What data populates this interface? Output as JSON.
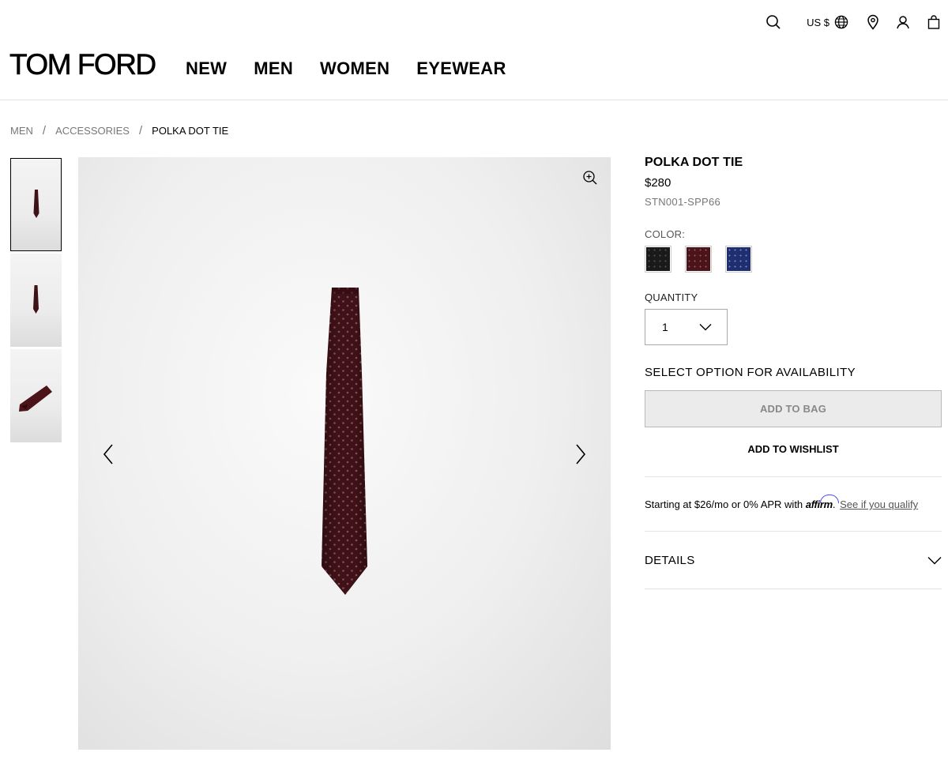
{
  "header": {
    "logo": "TOM FORD",
    "currency": "US $",
    "nav": [
      "NEW",
      "MEN",
      "WOMEN",
      "EYEWEAR"
    ],
    "icons": [
      "search-icon",
      "globe-icon",
      "location-pin-icon",
      "account-icon",
      "shopping-bag-icon"
    ]
  },
  "breadcrumb": [
    "MEN",
    "ACCESSORIES",
    "POLKA DOT TIE"
  ],
  "gallery": {
    "thumbnail_count": 3,
    "active_thumbnail": 0
  },
  "product": {
    "title": "POLKA DOT TIE",
    "price": "$280",
    "sku": "STN001-SPP66",
    "color_label": "COLOR:",
    "colors": [
      {
        "name": "black",
        "hex": "#1a1a1a"
      },
      {
        "name": "burgundy",
        "hex": "#4a1418"
      },
      {
        "name": "navy",
        "hex": "#1f2e6e"
      }
    ],
    "quantity_label": "QUANTITY",
    "quantity_value": "1",
    "availability_text": "SELECT OPTION FOR AVAILABILITY",
    "add_to_bag": "ADD TO BAG",
    "add_to_wishlist": "ADD TO WISHLIST",
    "financing": {
      "prefix": "Starting at $26/mo or 0% APR with",
      "brand": "affirm",
      "link": "See if you qualify"
    },
    "details_label": "DETAILS"
  }
}
